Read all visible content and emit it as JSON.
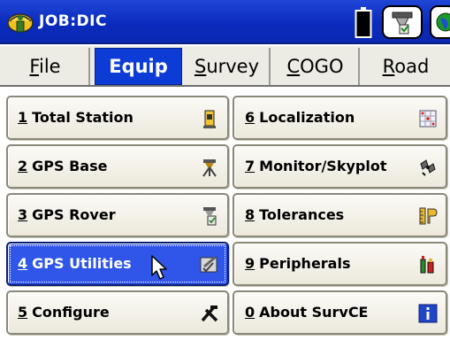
{
  "title": "JOB:DIC",
  "icons": {
    "app": "surveyor-helmet-icon",
    "battery": "battery-icon",
    "receiver": "gps-receiver-icon",
    "globe": "globe-icon"
  },
  "tabs": [
    {
      "pre": "",
      "ul": "F",
      "post": "ile",
      "active": false
    },
    {
      "pre": "",
      "ul": "",
      "post": "Equip",
      "active": true
    },
    {
      "pre": "",
      "ul": "S",
      "post": "urvey",
      "active": false
    },
    {
      "pre": "",
      "ul": "C",
      "post": "OGO",
      "active": false
    },
    {
      "pre": "",
      "ul": "R",
      "post": "oad",
      "active": false
    }
  ],
  "buttons": [
    {
      "num": "1",
      "label": "Total Station",
      "icon": "total-station-icon",
      "selected": false
    },
    {
      "num": "2",
      "label": "GPS Base",
      "icon": "gps-base-icon",
      "selected": false
    },
    {
      "num": "3",
      "label": "GPS Rover",
      "icon": "gps-rover-icon",
      "selected": false
    },
    {
      "num": "4",
      "label": "GPS Utilities",
      "icon": "gps-utilities-icon",
      "selected": true
    },
    {
      "num": "5",
      "label": "Configure",
      "icon": "tools-icon",
      "selected": false
    },
    {
      "num": "6",
      "label": "Localization",
      "icon": "localization-grid-icon",
      "selected": false
    },
    {
      "num": "7",
      "label": "Monitor/Skyplot",
      "icon": "skyplot-icon",
      "selected": false
    },
    {
      "num": "8",
      "label": "Tolerances",
      "icon": "tolerances-icon",
      "selected": false
    },
    {
      "num": "9",
      "label": "Peripherals",
      "icon": "peripherals-icon",
      "selected": false
    },
    {
      "num": "0",
      "label": "About SurvCE",
      "icon": "info-icon",
      "selected": false
    }
  ],
  "colors": {
    "titlebar": "#0b2bbd",
    "active_tab": "#0c3bd6",
    "selected_button": "#2f56e8"
  }
}
